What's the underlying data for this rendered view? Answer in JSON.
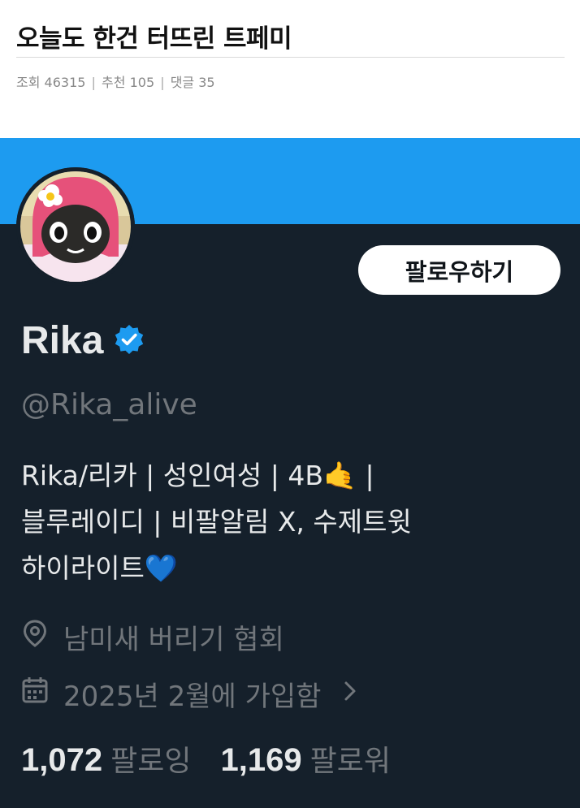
{
  "post": {
    "title": "오늘도 한건 터뜨린 트페미",
    "views_label": "조회",
    "views": "46315",
    "recommend_label": "추천",
    "recommend": "105",
    "comments_label": "댓글",
    "comments": "35",
    "separator": "|"
  },
  "profile": {
    "banner_color": "#1d9bf0",
    "background_color": "#15202b",
    "follow_button": "팔로우하기",
    "display_name": "Rika",
    "verified_icon": "verified-badge-icon",
    "handle": "@Rika_alive",
    "bio_line1": "Rika/리카 | 성인여성 | 4B🤙 |",
    "bio_line2": "블루레이디 | 비팔알림 X, 수제트윗",
    "bio_line3": "하이라이트💙",
    "location_icon": "location-pin-icon",
    "location": "남미새 버리기 협회",
    "calendar_icon": "calendar-icon",
    "joined": "2025년 2월에 가입함",
    "chevron_icon": "chevron-right-icon",
    "following_count": "1,072",
    "following_label": "팔로잉",
    "followers_count": "1,169",
    "followers_label": "팔로워"
  }
}
